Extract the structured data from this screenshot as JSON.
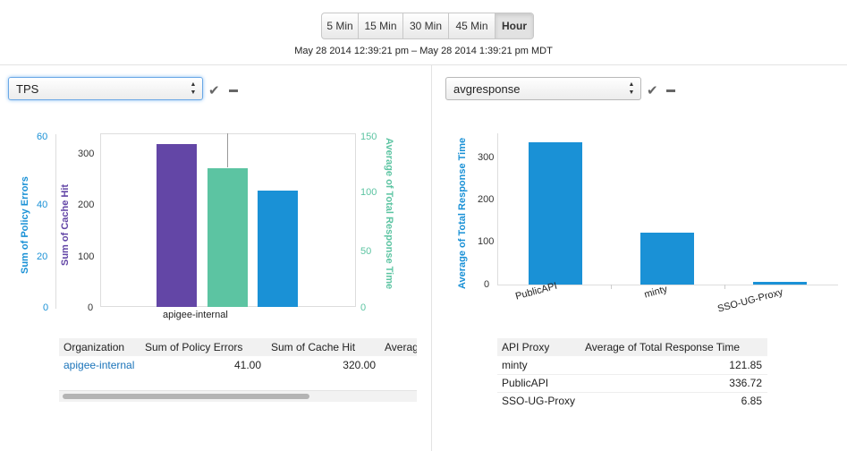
{
  "time_range": {
    "buttons": [
      "5 Min",
      "15 Min",
      "30 Min",
      "45 Min",
      "Hour"
    ],
    "active": "Hour",
    "date_range": "May 28 2014 12:39:21 pm – May 28 2014 1:39:21 pm MDT"
  },
  "left_panel": {
    "select_value": "TPS",
    "table": {
      "headers": [
        "Organization",
        "Sum of Policy Errors",
        "Sum of Cache Hit",
        "Averag"
      ],
      "rows": [
        [
          "apigee-internal",
          "41.00",
          "320.00",
          ""
        ]
      ]
    }
  },
  "right_panel": {
    "select_value": "avgresponse",
    "table": {
      "headers": [
        "API Proxy",
        "Average of Total Response Time"
      ],
      "rows": [
        [
          "minty",
          "121.85"
        ],
        [
          "PublicAPI",
          "336.72"
        ],
        [
          "SSO-UG-Proxy",
          "6.85"
        ]
      ]
    }
  },
  "colors": {
    "purple": "#6346a6",
    "teal": "#5cc4a2",
    "blue": "#1a91d6",
    "link": "#1a73b9"
  },
  "chart_data": [
    {
      "type": "bar",
      "categories": [
        "apigee-internal"
      ],
      "series": [
        {
          "name": "Sum of Policy Errors",
          "values": [
            41
          ]
        },
        {
          "name": "Sum of Cache Hit",
          "values": [
            320
          ]
        },
        {
          "name": "Average of Total Response Time",
          "values": [
            122
          ]
        }
      ],
      "axes": [
        {
          "label": "Sum of Policy Errors",
          "ticks": [
            "0",
            "20",
            "40",
            "60"
          ],
          "ylim": [
            0,
            60
          ]
        },
        {
          "label": "Sum of Cache Hit",
          "ticks": [
            "0",
            "100",
            "200",
            "300"
          ],
          "ylim": [
            0,
            330
          ]
        },
        {
          "label": "Average of Total Response Time",
          "ticks": [
            "0",
            "50",
            "100",
            "150"
          ],
          "ylim": [
            0,
            150
          ]
        }
      ],
      "grid": false
    },
    {
      "type": "bar",
      "categories": [
        "PublicAPI",
        "minty",
        "SSO-UG-Proxy"
      ],
      "series": [
        {
          "name": "Average of Total Response Time",
          "values": [
            336.72,
            121.85,
            6.85
          ]
        }
      ],
      "ylabel": "Average of Total Response Time",
      "yticks": [
        "0",
        "100",
        "200",
        "300"
      ],
      "ylim": [
        0,
        350
      ],
      "grid": false
    }
  ]
}
